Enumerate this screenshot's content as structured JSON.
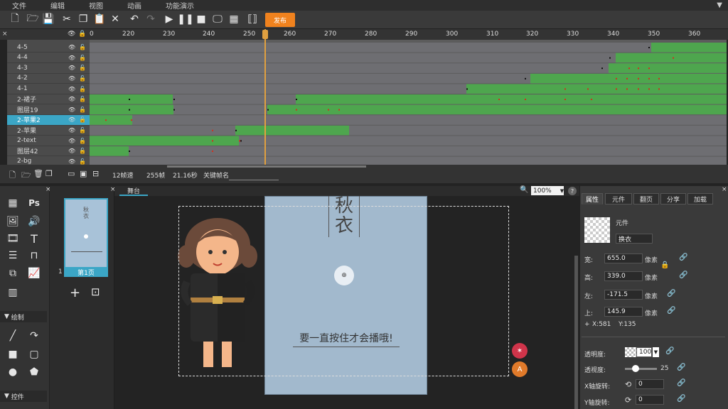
{
  "menu": [
    "文件",
    "编辑",
    "视图",
    "动画",
    "功能演示"
  ],
  "toolbar": {
    "publish_label": "发布"
  },
  "ruler": [
    "220",
    "230",
    "240",
    "250",
    "260",
    "270",
    "280",
    "290",
    "300",
    "310",
    "320",
    "330",
    "340",
    "350",
    "360"
  ],
  "ruler_zero": "0",
  "layers": [
    {
      "name": "4-5",
      "selected": false
    },
    {
      "name": "4-4",
      "selected": false
    },
    {
      "name": "4-3",
      "selected": false
    },
    {
      "name": "4-2",
      "selected": false
    },
    {
      "name": "4-1",
      "selected": false
    },
    {
      "name": "2-裙子",
      "selected": false
    },
    {
      "name": "图层19",
      "selected": false
    },
    {
      "name": "2-苹果2",
      "selected": true
    },
    {
      "name": "2-苹果",
      "selected": false
    },
    {
      "name": "2-text",
      "selected": false
    },
    {
      "name": "图层42",
      "selected": false
    },
    {
      "name": "2-bg",
      "selected": false
    }
  ],
  "timeline_footer": {
    "fps": "12帧速",
    "frames": "255帧",
    "duration": "21.16秒",
    "keyframe_label": "关键帧名"
  },
  "tools": {
    "ps_label": "Ps",
    "text_label": "T",
    "draw_section": "绘制",
    "control_section": "控件"
  },
  "pages": {
    "index": "1",
    "label": "第1页"
  },
  "stage": {
    "tab": "舞台",
    "zoom": "100%",
    "title_char_1": "秋",
    "title_char_2": "衣",
    "caption": "要一直按住才会播哦!"
  },
  "props": {
    "tabs": [
      "属性",
      "元件",
      "翻页",
      "分享",
      "加载"
    ],
    "type_label": "元件",
    "name_value": "换衣",
    "width_label": "宽:",
    "width_value": "655.0",
    "height_label": "高:",
    "height_value": "339.0",
    "left_label": "左:",
    "left_value": "-171.5",
    "top_label": "上:",
    "top_value": "145.9",
    "unit": "像素",
    "x_readout": "X:581",
    "y_readout": "Y:135",
    "opacity_label": "透明度:",
    "opacity_value": "100",
    "perspective_label": "透视度:",
    "perspective_value": "25",
    "xrot_label": "X轴旋转:",
    "xrot_value": "0",
    "yrot_label": "Y轴旋转:",
    "yrot_value": "0"
  },
  "colors": {
    "accent": "#3ba6c6",
    "publish": "#f0821e",
    "track_green": "#4ea64e",
    "track_gray": "#6e6e72",
    "keyframe_red": "#d03020",
    "canvas": "#a2b9cd"
  }
}
